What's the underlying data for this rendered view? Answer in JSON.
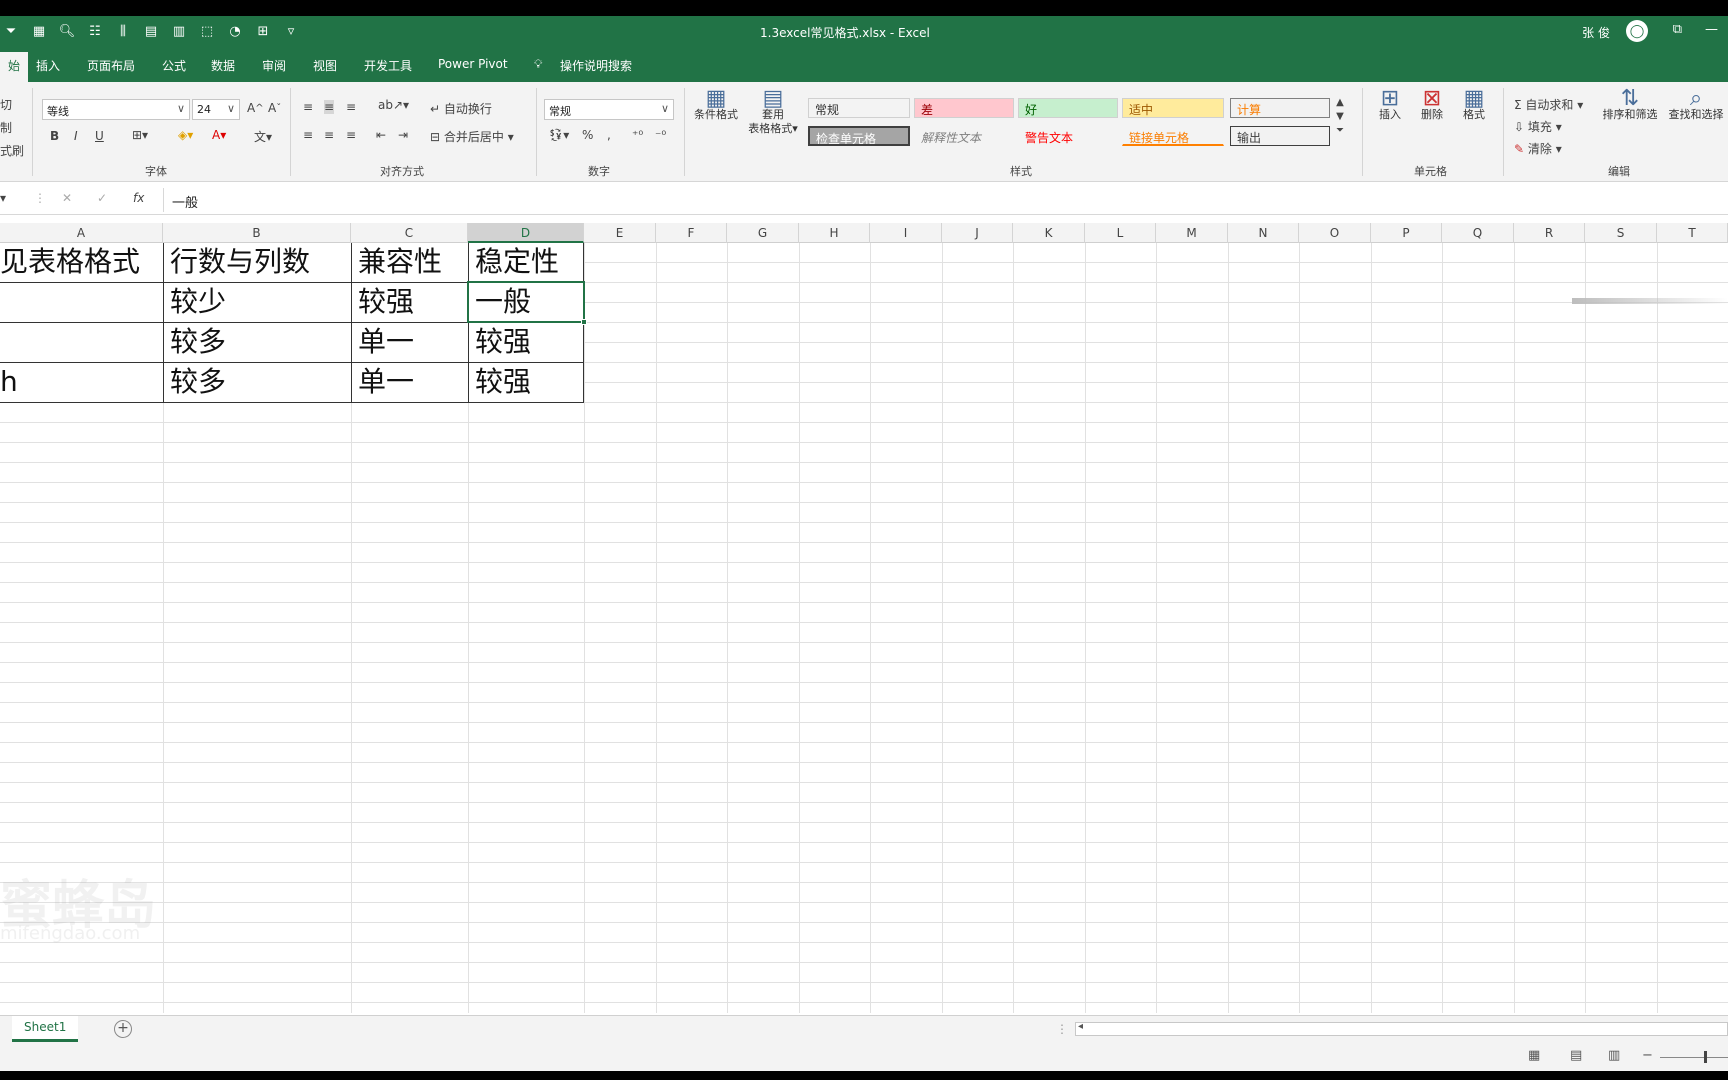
{
  "title_bar": {
    "title": "1.3excel常见格式.xlsx  -  Excel",
    "user": "张 俊",
    "qat_icons": [
      "filter-icon",
      "table-icon",
      "preview-icon",
      "sort-icon",
      "columns-icon",
      "calc-icon",
      "sheet-icon",
      "select-icon",
      "shape-icon",
      "group-icon",
      "more-icon"
    ]
  },
  "tabs": {
    "home": "始",
    "insert": "插入",
    "layout": "页面布局",
    "formula": "公式",
    "data": "数据",
    "review": "审阅",
    "view": "视图",
    "dev": "开发工具",
    "powerpivot": "Power Pivot",
    "search": "操作说明搜索"
  },
  "ribbon": {
    "clipboard": {
      "cut": "切",
      "copy": "制",
      "painter": "式刷"
    },
    "font": {
      "name": "等线",
      "size": "24",
      "group": "字体",
      "bold": "B",
      "italic": "I",
      "underline": "U"
    },
    "align": {
      "wrap": "自动换行",
      "merge": "合并后居中",
      "group": "对齐方式"
    },
    "number": {
      "format": "常规",
      "group": "数字",
      "percent": "%",
      "comma": ","
    },
    "styles": {
      "cond": "条件格式",
      "table_top": "套用",
      "table_bottom": "表格格式",
      "group": "样式",
      "cells": [
        {
          "label": "常规",
          "bg": "#ffffff",
          "color": "#222222"
        },
        {
          "label": "差",
          "bg": "#ffc7ce",
          "color": "#9c0006"
        },
        {
          "label": "好",
          "bg": "#c6efce",
          "color": "#006100"
        },
        {
          "label": "适中",
          "bg": "#ffeb9c",
          "color": "#9c5700"
        },
        {
          "label": "计算",
          "bg": "#f2f2f2",
          "color": "#fa7d00"
        },
        {
          "label": "检查单元格",
          "bg": "#a5a5a5",
          "color": "#ffffff"
        },
        {
          "label": "解释性文本",
          "bg": "#f3f3f3",
          "color": "#7f7f7f"
        },
        {
          "label": "警告文本",
          "bg": "#f3f3f3",
          "color": "#ff0000"
        },
        {
          "label": "链接单元格",
          "bg": "#f3f3f3",
          "color": "#fa7d00"
        },
        {
          "label": "输出",
          "bg": "#f2f2f2",
          "color": "#3f3f3f"
        }
      ]
    },
    "cells_group": {
      "insert": "插入",
      "delete": "删除",
      "format": "格式",
      "group": "单元格"
    },
    "editing": {
      "autosum": "自动求和",
      "fill": "填充",
      "clear": "清除",
      "sort": "排序和筛选",
      "find": "查找和选择",
      "group": "编辑"
    }
  },
  "formula_bar": {
    "cancel": "✕",
    "enter": "✓",
    "fx": "fx",
    "value": "一般"
  },
  "columns": [
    "A",
    "B",
    "C",
    "D",
    "E",
    "F",
    "G",
    "H",
    "I",
    "J",
    "K",
    "L",
    "M",
    "N",
    "O",
    "P",
    "Q",
    "R",
    "S",
    "T"
  ],
  "table": {
    "header": [
      "见表格格式",
      "行数与列数",
      "兼容性",
      "稳定性"
    ],
    "rows": [
      [
        "",
        "较少",
        "较强",
        "一般"
      ],
      [
        "",
        "较多",
        "单一",
        "较强"
      ],
      [
        "h",
        "较多",
        "单一",
        "较强"
      ]
    ]
  },
  "watermark": {
    "main": "蜜蜂岛",
    "sub": "mifengdao.com"
  },
  "sheet": {
    "name": "Sheet1",
    "add": "+"
  },
  "status": {
    "zoom_minus": "−"
  }
}
